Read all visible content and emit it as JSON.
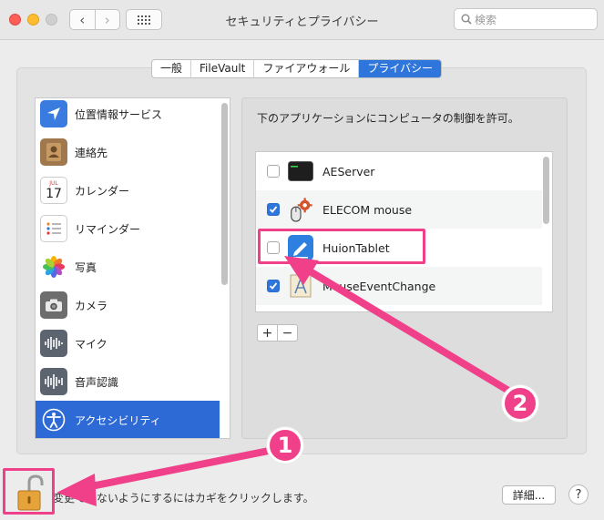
{
  "window": {
    "title": "セキュリティとプライバシー",
    "back_label": "‹",
    "forward_label": "›",
    "search_placeholder": "検索"
  },
  "tabs": [
    {
      "label": "一般",
      "active": false
    },
    {
      "label": "FileVault",
      "active": false
    },
    {
      "label": "ファイアウォール",
      "active": false
    },
    {
      "label": "プライバシー",
      "active": true
    }
  ],
  "categories": [
    {
      "label": "位置情報サービス",
      "icon": "location-arrow-icon",
      "selected": false
    },
    {
      "label": "連絡先",
      "icon": "contacts-book-icon",
      "selected": false
    },
    {
      "label": "カレンダー",
      "icon": "calendar-icon",
      "day": "17",
      "month": "JUL",
      "selected": false
    },
    {
      "label": "リマインダー",
      "icon": "reminders-list-icon",
      "selected": false
    },
    {
      "label": "写真",
      "icon": "photos-flower-icon",
      "selected": false
    },
    {
      "label": "カメラ",
      "icon": "camera-icon",
      "selected": false
    },
    {
      "label": "マイク",
      "icon": "microphone-waveform-icon",
      "selected": false
    },
    {
      "label": "音声認識",
      "icon": "speech-waveform-icon",
      "selected": false
    },
    {
      "label": "アクセシビリティ",
      "icon": "accessibility-person-icon",
      "selected": true
    }
  ],
  "privacy": {
    "allow_text": "下のアプリケーションにコンピュータの制御を許可。",
    "apps": [
      {
        "name": "AEServer",
        "checked": false,
        "icon": "terminal-icon"
      },
      {
        "name": "ELECOM mouse",
        "checked": true,
        "icon": "mouse-gear-icon"
      },
      {
        "name": "HuionTablet",
        "checked": false,
        "icon": "huion-pen-icon"
      },
      {
        "name": "MouseEventChange",
        "checked": true,
        "icon": "app-blueprint-icon"
      }
    ],
    "add_label": "+",
    "remove_label": "−"
  },
  "footer": {
    "lock_message": "変更できないようにするにはカギをクリックします。",
    "details_label": "詳細...",
    "help_label": "?"
  },
  "annotations": {
    "badge1": "1",
    "badge2": "2"
  },
  "colors": {
    "accent": "#2f76dc",
    "selection": "#2e6ad6",
    "highlight": "#f0408a"
  }
}
